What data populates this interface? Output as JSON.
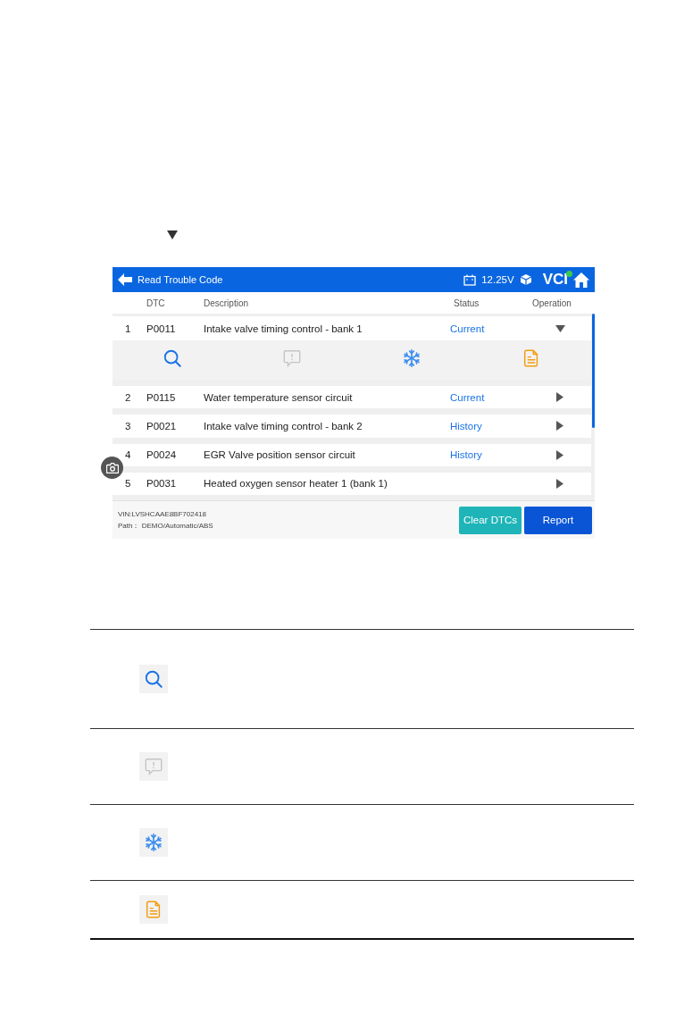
{
  "app_bar": {
    "title": "Read Trouble Code",
    "voltage": "12.25V",
    "vci_label": "VCI"
  },
  "columns": [
    "DTC",
    "Description",
    "Status",
    "Operation"
  ],
  "rows": [
    {
      "number": "1",
      "code": "P0011",
      "description": "Intake valve timing control - bank 1",
      "status": "Current",
      "expanded": true
    },
    {
      "number": "2",
      "code": "P0115",
      "description": "Water temperature sensor circuit",
      "status": "Current",
      "expanded": false
    },
    {
      "number": "3",
      "code": "P0021",
      "description": "Intake valve timing control - bank 2",
      "status": "History",
      "expanded": false
    },
    {
      "number": "4",
      "code": "P0024",
      "description": "EGR Valve position sensor circuit",
      "status": "History",
      "expanded": false
    },
    {
      "number": "5",
      "code": "P0031",
      "description": "Heated oxygen sensor heater 1 (bank 1)",
      "expanded": false
    }
  ],
  "actions": [
    {
      "kind": "search",
      "disabled": false
    },
    {
      "kind": "comment",
      "disabled": true
    },
    {
      "kind": "freeze",
      "disabled": false
    },
    {
      "kind": "report",
      "disabled": false
    }
  ],
  "footer": {
    "vin": "VIN:LVSHCAAE8BF702418",
    "path": "Path： DEMO/Automatic/ABS"
  },
  "buttons": [
    {
      "label": "Clear DTCs",
      "kind": "secondary"
    },
    {
      "label": "Report",
      "kind": "primary"
    }
  ],
  "legend": [
    {
      "kind": "search"
    },
    {
      "kind": "comment"
    },
    {
      "kind": "freeze"
    },
    {
      "kind": "report"
    }
  ]
}
